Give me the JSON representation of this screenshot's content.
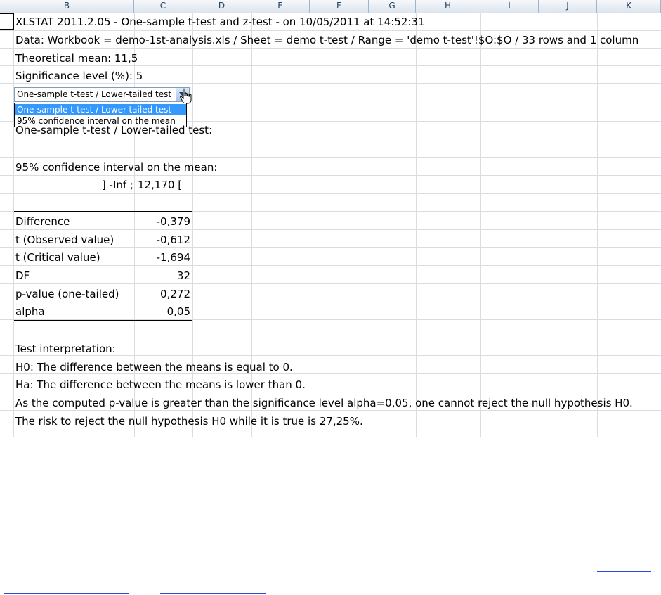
{
  "columns": [
    "B",
    "C",
    "D",
    "E",
    "F",
    "G",
    "H",
    "I",
    "J",
    "K"
  ],
  "report": {
    "title": "XLSTAT 2011.2.05 - One-sample t-test and z-test - on 10/05/2011 at 14:52:31",
    "data_line": "Data: Workbook = demo-1st-analysis.xls / Sheet = demo t-test / Range = 'demo t-test'!$O:$O / 33 rows and 1 column",
    "theoretical_mean": "Theoretical mean: 11,5",
    "significance_level": "Significance level (%): 5"
  },
  "combo": {
    "value": "One-sample t-test / Lower-tailed test",
    "options": [
      "One-sample t-test / Lower-tailed test",
      "95% confidence interval on the mean"
    ],
    "selected_index": 0
  },
  "section_heading": "One-sample t-test / Lower-tailed test:",
  "ci": {
    "heading": "95% confidence interval on the mean:",
    "lower": "] -Inf ;",
    "upper": "12,170 ["
  },
  "results": [
    {
      "label": "Difference",
      "value": "-0,379"
    },
    {
      "label": "t (Observed value)",
      "value": "-0,612"
    },
    {
      "label": "t (Critical value)",
      "value": "-1,694"
    },
    {
      "label": "DF",
      "value": "32"
    },
    {
      "label": "p-value (one-tailed)",
      "value": "0,272"
    },
    {
      "label": "alpha",
      "value": "0,05"
    }
  ],
  "interpretation": {
    "heading": "Test interpretation:",
    "h0": "H0: The difference between the means is equal to 0.",
    "ha": "Ha: The difference between the means is lower than 0.",
    "conclusion": "As the computed p-value is greater than the significance level alpha=0,05, one cannot reject the null hypothesis H0.",
    "risk": "The risk to reject the null hypothesis H0 while it is true is 27,25%."
  },
  "colors": {
    "grid": "#d8dde4",
    "header_text": "#27415f",
    "selection": "#3399ff",
    "link": "#2b4bd6"
  }
}
